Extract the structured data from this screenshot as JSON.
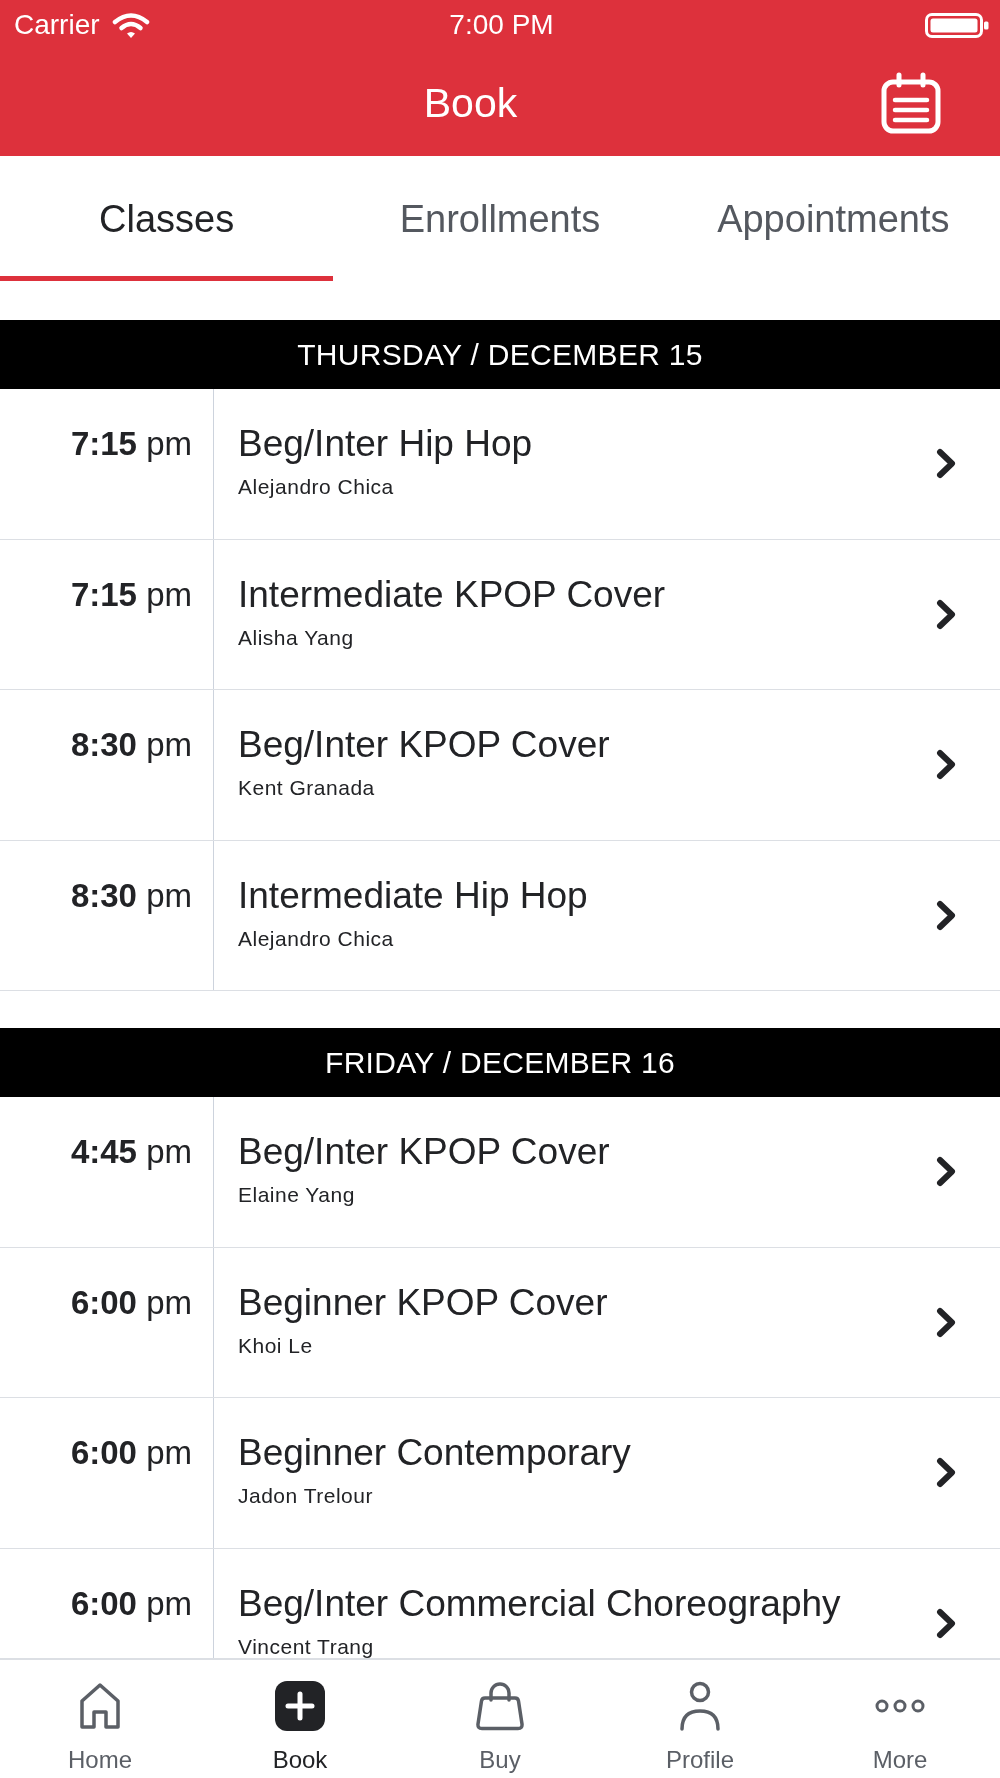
{
  "status_bar": {
    "carrier": "Carrier",
    "time": "7:00 PM"
  },
  "header": {
    "title": "Book"
  },
  "tabs": [
    {
      "label": "Classes",
      "selected": true
    },
    {
      "label": "Enrollments",
      "selected": false
    },
    {
      "label": "Appointments",
      "selected": false
    }
  ],
  "schedule": [
    {
      "day": "THURSDAY / DECEMBER 15",
      "classes": [
        {
          "time": "**7:15** pm",
          "name": "Beg/Inter Hip Hop",
          "instructor": "Alejandro Chica"
        },
        {
          "time": "**7:15** pm",
          "name": "Intermediate KPOP Cover",
          "instructor": "Alisha Yang"
        },
        {
          "time": "**8:30** pm",
          "name": "Beg/Inter KPOP Cover",
          "instructor": "Kent Granada"
        },
        {
          "time": "**8:30** pm",
          "name": "Intermediate Hip Hop",
          "instructor": "Alejandro Chica"
        }
      ]
    },
    {
      "day": "FRIDAY / DECEMBER 16",
      "classes": [
        {
          "time": "**4:45** pm",
          "name": "Beg/Inter KPOP Cover",
          "instructor": "Elaine Yang"
        },
        {
          "time": "**6:00** pm",
          "name": "Beginner KPOP Cover",
          "instructor": "Khoi Le"
        },
        {
          "time": "**6:00** pm",
          "name": "Beginner Contemporary",
          "instructor": "Jadon Trelour"
        },
        {
          "time": "**6:00** pm",
          "name": "Beg/Inter Commercial Choreography",
          "instructor": "Vincent Trang"
        }
      ]
    }
  ],
  "tab_bar": [
    {
      "label": "Home",
      "selected": false
    },
    {
      "label": "Book",
      "selected": true
    },
    {
      "label": "Buy",
      "selected": false
    },
    {
      "label": "Profile",
      "selected": false
    },
    {
      "label": "More",
      "selected": false
    }
  ]
}
